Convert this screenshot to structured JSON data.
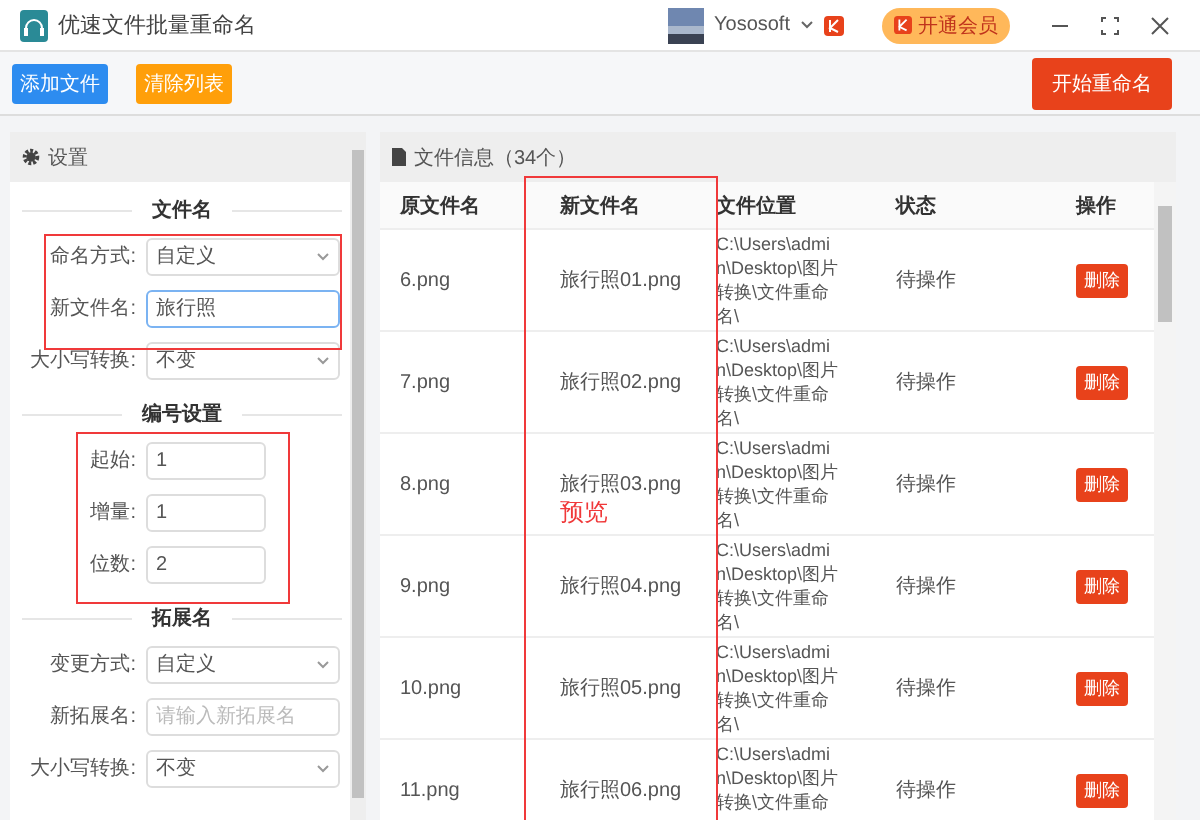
{
  "window": {
    "title": "优速文件批量重命名",
    "user": "Yososoft",
    "vip_button": "开通会员"
  },
  "toolbar": {
    "add_button": "添加文件",
    "clear_button": "清除列表",
    "start_button": "开始重命名"
  },
  "settings": {
    "title": "设置",
    "sections": [
      {
        "heading": "文件名",
        "fields": [
          {
            "label": "命名方式:",
            "kind": "select",
            "value": "自定义",
            "focused": false
          },
          {
            "label": "新文件名:",
            "kind": "input",
            "value": "旅行照",
            "focused": true
          },
          {
            "label": "大小写转换:",
            "kind": "select",
            "value": "不变",
            "focused": false
          }
        ]
      },
      {
        "heading": "编号设置",
        "fields": [
          {
            "label": "起始:",
            "kind": "short",
            "value": "1",
            "focused": false
          },
          {
            "label": "增量:",
            "kind": "short",
            "value": "1",
            "focused": false
          },
          {
            "label": "位数:",
            "kind": "short",
            "value": "2",
            "focused": false
          }
        ]
      },
      {
        "heading": "拓展名",
        "fields": [
          {
            "label": "变更方式:",
            "kind": "select",
            "value": "自定义",
            "focused": false
          },
          {
            "label": "新拓展名:",
            "kind": "input",
            "placeholder": "请输入新拓展名",
            "focused": false
          },
          {
            "label": "大小写转换:",
            "kind": "select",
            "value": "不变",
            "focused": false
          }
        ]
      }
    ]
  },
  "files": {
    "title": "文件信息（34个）",
    "columns": [
      "原文件名",
      "新文件名",
      "文件位置",
      "状态",
      "操作"
    ],
    "rows": [
      {
        "original": "6.png",
        "new_name": "旅行照01.png",
        "location": "C:\\Users\\admin\\Desktop\\图片转换\\文件重命名\\",
        "status": "待操作",
        "action": "删除"
      },
      {
        "original": "7.png",
        "new_name": "旅行照02.png",
        "location": "C:\\Users\\admin\\Desktop\\图片转换\\文件重命名\\",
        "status": "待操作",
        "action": "删除"
      },
      {
        "original": "8.png",
        "new_name": "旅行照03.png",
        "location": "C:\\Users\\admin\\Desktop\\图片转换\\文件重命名\\",
        "status": "待操作",
        "action": "删除"
      },
      {
        "original": "9.png",
        "new_name": "旅行照04.png",
        "location": "C:\\Users\\admin\\Desktop\\图片转换\\文件重命名\\",
        "status": "待操作",
        "action": "删除"
      },
      {
        "original": "10.png",
        "new_name": "旅行照05.png",
        "location": "C:\\Users\\admin\\Desktop\\图片转换\\文件重命名\\",
        "status": "待操作",
        "action": "删除"
      },
      {
        "original": "11.png",
        "new_name": "旅行照06.png",
        "location": "C:\\Users\\admin\\Desktop\\图片转换\\文件重命",
        "status": "待操作",
        "action": "删除"
      }
    ]
  },
  "annotation": {
    "label": "预览"
  }
}
